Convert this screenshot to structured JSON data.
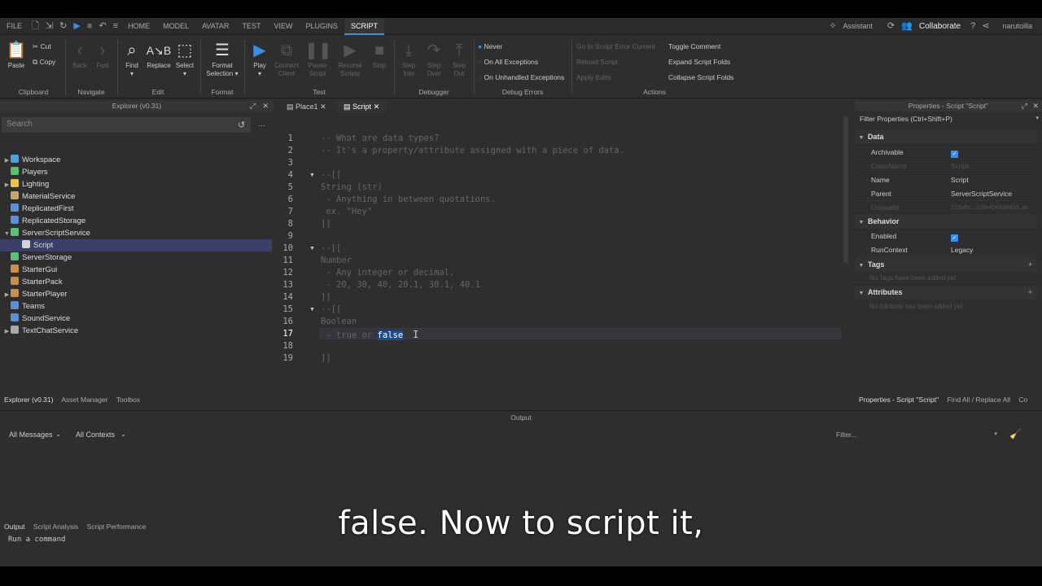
{
  "menubar": {
    "tabs": [
      "FILE",
      "HOME",
      "MODEL",
      "AVATAR",
      "TEST",
      "VIEW",
      "PLUGINS",
      "SCRIPT"
    ],
    "active_tab": "SCRIPT",
    "assistant": "Assistant",
    "collaborate": "Collaborate",
    "username": "narutoilla"
  },
  "ribbon": {
    "clipboard": {
      "paste": "Paste",
      "cut": "Cut",
      "copy": "Copy",
      "group": "Clipboard"
    },
    "navigate": {
      "back": "Back",
      "fwd": "Fwd",
      "group": "Navigate"
    },
    "edit": {
      "find": "Find",
      "replace": "Replace",
      "select": "Select",
      "group": "Edit"
    },
    "format": {
      "format_selection_1": "Format",
      "format_selection_2": "Selection",
      "group": "Format"
    },
    "test": {
      "play": "Play",
      "connect_1": "Connect",
      "connect_2": "Client",
      "pause_1": "Pause",
      "pause_2": "Script",
      "resume_1": "Resume",
      "resume_2": "Scripts",
      "stop": "Stop",
      "group": "Test"
    },
    "debugger": {
      "step_into_1": "Step",
      "step_into_2": "Into",
      "step_over_1": "Step",
      "step_over_2": "Over",
      "step_out_1": "Step",
      "step_out_2": "Out",
      "group": "Debugger"
    },
    "debug_errors": {
      "never": "Never",
      "all": "On All Exceptions",
      "unhandled": "On Unhandled Exceptions",
      "group": "Debug Errors"
    },
    "actions": {
      "goto_error": "Go to Script Error",
      "goto_error_tail": "Current",
      "reload": "Reload Script",
      "apply": "Apply Edits",
      "toggle_comment": "Toggle Comment",
      "expand": "Expand Script Folds",
      "collapse": "Collapse Script Folds",
      "group": "Actions"
    }
  },
  "explorer": {
    "title": "Explorer (v0.31)",
    "search_placeholder": "Search",
    "items": [
      {
        "label": "Workspace",
        "color": "#4aa3df",
        "arrow": "▶"
      },
      {
        "label": "Players",
        "color": "#55c46b",
        "arrow": ""
      },
      {
        "label": "Lighting",
        "color": "#e8c547",
        "arrow": "▶"
      },
      {
        "label": "MaterialService",
        "color": "#c9a36a",
        "arrow": ""
      },
      {
        "label": "ReplicatedFirst",
        "color": "#5b8fd6",
        "arrow": ""
      },
      {
        "label": "ReplicatedStorage",
        "color": "#5b8fd6",
        "arrow": ""
      },
      {
        "label": "ServerScriptService",
        "color": "#5cbf7a",
        "arrow": "▼"
      },
      {
        "label": "Script",
        "color": "#d6d6d6",
        "arrow": ""
      },
      {
        "label": "ServerStorage",
        "color": "#5cbf7a",
        "arrow": ""
      },
      {
        "label": "StarterGui",
        "color": "#c98f4a",
        "arrow": ""
      },
      {
        "label": "StarterPack",
        "color": "#c98f4a",
        "arrow": ""
      },
      {
        "label": "StarterPlayer",
        "color": "#c98f4a",
        "arrow": "▶"
      },
      {
        "label": "Teams",
        "color": "#5b8fd6",
        "arrow": ""
      },
      {
        "label": "SoundService",
        "color": "#5b8fd6",
        "arrow": ""
      },
      {
        "label": "TextChatService",
        "color": "#aaaaaa",
        "arrow": "▶"
      }
    ],
    "bottom_tabs": [
      "Explorer (v0.31)",
      "Asset Manager",
      "Toolbox"
    ]
  },
  "editor": {
    "tabs": [
      "Place1",
      "Script"
    ],
    "active_tab": "Script",
    "lines": [
      "-- What are data types?",
      "-- It's a property/attribute assigned with a piece of data.",
      "",
      "--[[",
      "String (str)",
      " - Anything in between quotations.",
      " ex. \"Hey\"",
      "]]",
      "",
      "--[[",
      "Number",
      " - Any integer or decimal.",
      " - 20, 30, 40, 20.1, 30.1, 40.1",
      "]]",
      "--[[",
      "Boolean",
      " - true or ",
      "",
      "]]"
    ],
    "line_numbers": [
      "1",
      "2",
      "3",
      "4",
      "5",
      "6",
      "7",
      "8",
      "9",
      "10",
      "11",
      "12",
      "13",
      "14",
      "15",
      "16",
      "17",
      "18",
      "19"
    ],
    "selected_word": "false",
    "current_line": 17
  },
  "properties": {
    "title": "Properties - Script \"Script\"",
    "filter_placeholder": "Filter Properties (Ctrl+Shift+P)",
    "sections": {
      "data": "Data",
      "behavior": "Behavior",
      "tags": "Tags",
      "attributes": "Attributes"
    },
    "rows": {
      "archivable": "Archivable",
      "classname": "ClassName",
      "classname_v": "Script",
      "name": "Name",
      "name_v": "Script",
      "parent": "Parent",
      "parent_v": "ServerScriptService",
      "uniqueid": "UniqueId",
      "uniqueid_v": "722bf5c...228e4245d6fd33..ae",
      "enabled": "Enabled",
      "runcontext": "RunContext",
      "runcontext_v": "Legacy"
    },
    "tags_note": "No Tags have been added yet",
    "attributes_note": "No Attribute has been added yet",
    "bottom_tabs": [
      "Properties - Script \"Script\"",
      "Find All / Replace All",
      "Co"
    ]
  },
  "output": {
    "title": "Output",
    "messages_filter": "All Messages",
    "contexts_filter": "All Contexts",
    "filter_placeholder": "Filter...",
    "bottom_tabs": [
      "Output",
      "Script Analysis",
      "Script Performance"
    ],
    "command_placeholder": "Run a command"
  },
  "subtitle": "false. Now to script it,"
}
